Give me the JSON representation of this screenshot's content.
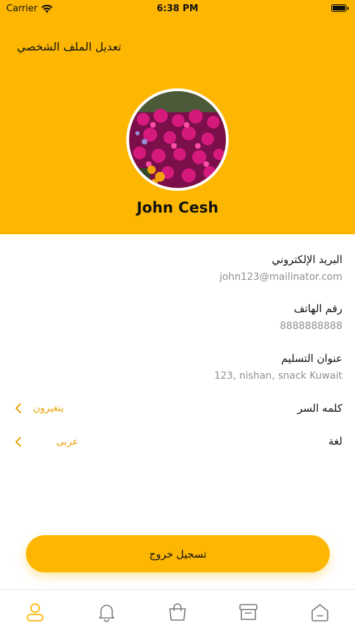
{
  "status_bar": {
    "carrier": "Carrier",
    "time": "6:38 PM"
  },
  "header": {
    "title": "تعديل الملف الشخصي",
    "user_name": "John Cesh"
  },
  "fields": [
    {
      "label": "البريد الإلكتروني",
      "value": "john123@mailinator.com"
    },
    {
      "label": "رقم الهاتف",
      "value": "8888888888"
    },
    {
      "label": "عنوان التسليم",
      "value": "123, nishan, snack Kuwait"
    }
  ],
  "settings": [
    {
      "label": "كلمه السر",
      "value": "يتغيرون"
    },
    {
      "label": "لغة",
      "value": "عربى"
    }
  ],
  "logout_label": "تسجيل خروج",
  "colors": {
    "accent": "#FDB702",
    "accent_text": "#E5A403"
  },
  "tabbar": {
    "items": [
      {
        "icon": "user-icon",
        "active": true
      },
      {
        "icon": "bell-icon",
        "active": false
      },
      {
        "icon": "bag-icon",
        "active": false
      },
      {
        "icon": "archive-icon",
        "active": false
      },
      {
        "icon": "home-icon",
        "active": false
      }
    ]
  }
}
